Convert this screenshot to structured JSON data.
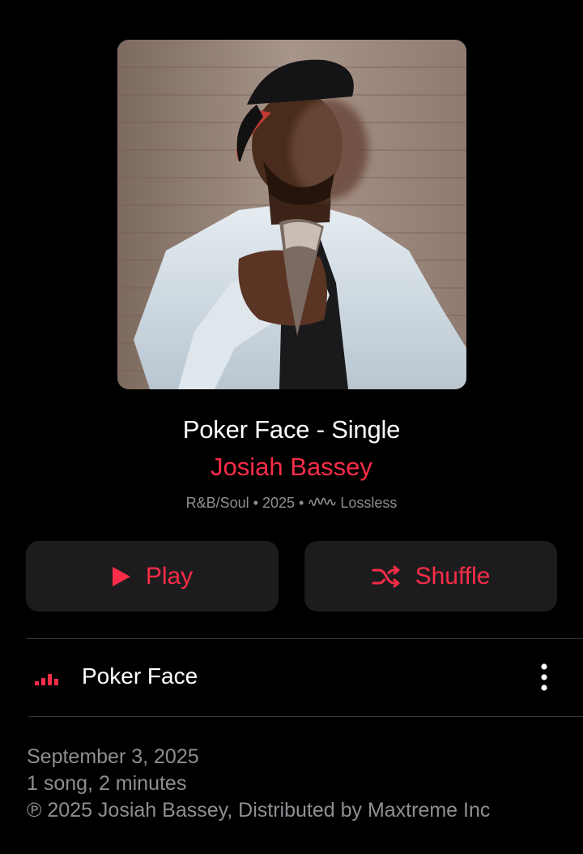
{
  "album": {
    "title": "Poker Face - Single",
    "artist": "Josiah Bassey",
    "genre": "R&B/Soul",
    "year": "2025",
    "quality": "Lossless",
    "artwork_icon": "album-artwork-image"
  },
  "actions": {
    "play_label": "Play",
    "shuffle_label": "Shuffle"
  },
  "tracks": [
    {
      "title": "Poker Face",
      "is_playing": true,
      "more_icon": "more-vertical-icon"
    }
  ],
  "footer": {
    "release_date": "September 3, 2025",
    "summary": "1 song, 2 minutes",
    "copyright": "℗ 2025 Josiah Bassey, Distributed by Maxtreme Inc"
  },
  "colors": {
    "accent": "#fa2d48",
    "background": "#000000",
    "button_bg": "#1c1c1e",
    "secondary_text": "#8e8e93",
    "separator": "#38383a"
  }
}
